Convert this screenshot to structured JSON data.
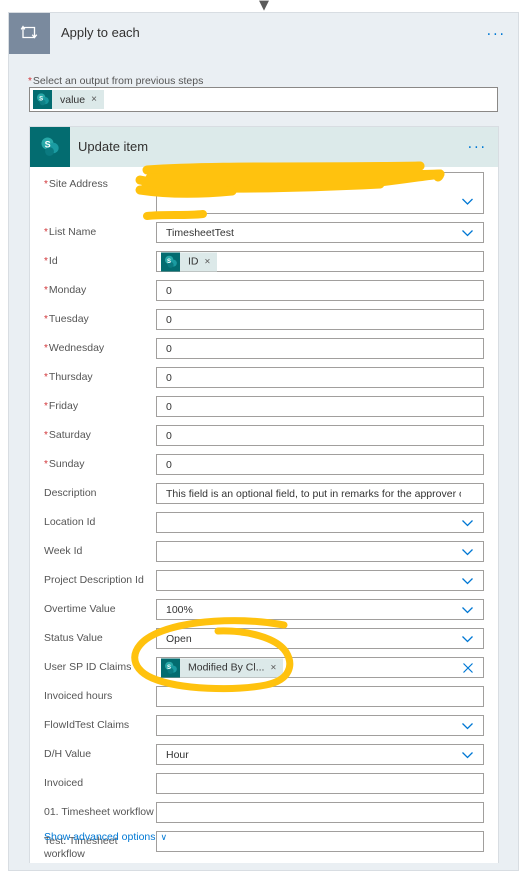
{
  "window": {
    "scroll_chevron": "chevron-down"
  },
  "loop_card": {
    "icon": "apply-to-each-loop-icon",
    "title": "Apply to each",
    "overflow": "···",
    "select_output": {
      "label": "Select an output from previous steps",
      "required": true,
      "token": {
        "icon": "sharepoint-icon",
        "text": "value",
        "remove": "×"
      }
    }
  },
  "action_card": {
    "icon": "sharepoint-icon",
    "title": "Update item",
    "overflow": "···",
    "advanced_options": {
      "label": "Show advanced options",
      "chevron": "∨"
    },
    "fields": [
      {
        "label": "Site Address",
        "required": true,
        "type": "dropdown",
        "value": "",
        "redacted": true,
        "multiline": true
      },
      {
        "label": "List Name",
        "required": true,
        "type": "dropdown",
        "value": "TimesheetTest",
        "redacted": true
      },
      {
        "label": "Id",
        "required": true,
        "type": "token",
        "token": {
          "icon": "sharepoint-icon",
          "text": "ID",
          "remove": "×"
        }
      },
      {
        "label": "Monday",
        "required": true,
        "type": "text",
        "value": "0"
      },
      {
        "label": "Tuesday",
        "required": true,
        "type": "text",
        "value": "0"
      },
      {
        "label": "Wednesday",
        "required": true,
        "type": "text",
        "value": "0"
      },
      {
        "label": "Thursday",
        "required": true,
        "type": "text",
        "value": "0"
      },
      {
        "label": "Friday",
        "required": true,
        "type": "text",
        "value": "0"
      },
      {
        "label": "Saturday",
        "required": true,
        "type": "text",
        "value": "0"
      },
      {
        "label": "Sunday",
        "required": true,
        "type": "text",
        "value": "0"
      },
      {
        "label": "Description",
        "required": false,
        "type": "text",
        "value": "This field is an optional field, to put in remarks for the approver or a remark on"
      },
      {
        "label": "Location Id",
        "required": false,
        "type": "dropdown",
        "value": ""
      },
      {
        "label": "Week Id",
        "required": false,
        "type": "dropdown",
        "value": ""
      },
      {
        "label": "Project Description Id",
        "required": false,
        "type": "dropdown",
        "value": ""
      },
      {
        "label": "Overtime Value",
        "required": false,
        "type": "dropdown",
        "value": "100%"
      },
      {
        "label": "Status Value",
        "required": false,
        "type": "dropdown",
        "value": "Open"
      },
      {
        "label": "User SP ID Claims",
        "required": false,
        "type": "token-clear",
        "token": {
          "icon": "sharepoint-icon",
          "text": "Modified By Cl...",
          "remove": "×"
        }
      },
      {
        "label": "Invoiced hours",
        "required": false,
        "type": "text",
        "value": ""
      },
      {
        "label": "FlowIdTest Claims",
        "required": false,
        "type": "dropdown",
        "value": ""
      },
      {
        "label": "D/H Value",
        "required": false,
        "type": "dropdown",
        "value": "Hour"
      },
      {
        "label": "Invoiced",
        "required": false,
        "type": "text",
        "value": ""
      },
      {
        "label": "01. Timesheet workflow",
        "required": false,
        "type": "text",
        "value": ""
      },
      {
        "label": "Test. Timesheet workflow",
        "required": false,
        "type": "text",
        "value": ""
      }
    ]
  },
  "annotations": {
    "color": "#FFC20E",
    "marks": [
      {
        "name": "redaction-site-address",
        "shape": "scribble"
      },
      {
        "name": "redaction-list-name",
        "shape": "stroke"
      },
      {
        "name": "highlight-circle-user-sp-id-claims",
        "shape": "ellipse"
      }
    ]
  },
  "colors": {
    "accent": "#0078d4",
    "sharepoint": "#036c70",
    "loop_header": "#7a8a9e",
    "card_background": "#eaeff3",
    "inner_header": "#dceaea",
    "required_star": "#d13438",
    "annotation_yellow": "#FFC20E"
  }
}
